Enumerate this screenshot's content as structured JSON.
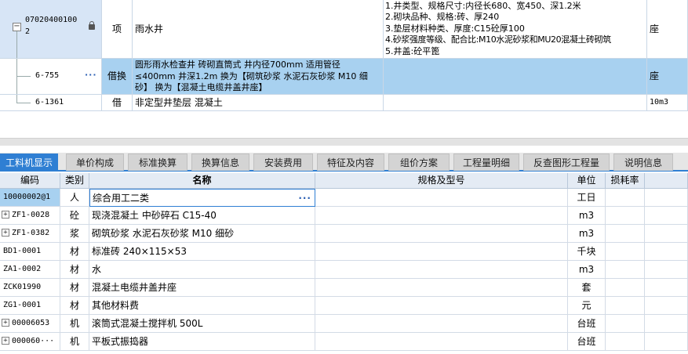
{
  "top_rows": [
    {
      "code": "070204001002",
      "code_line1": "07020400100",
      "code_line2": "2",
      "category": "项",
      "name": "雨水井",
      "features": [
        "1.井类型、规格尺寸:内径长680、宽450、深1.2米",
        "2.砌块品种、规格:砖、厚240",
        "3.垫层材料种类、厚度:C15砼厚100",
        "4.砂浆强度等级、配合比:M10水泥砂浆和MU20混凝土砖砌筑",
        "5.井盖:砼平篦"
      ],
      "unit": "座"
    },
    {
      "code": "6-755",
      "ellipsis": "···",
      "category": "借换",
      "name_lines": [
        "圆形雨水检查井 砖砌直筒式 井内径700mm 适用管径",
        "≤400mm 井深1.2m  换为【砌筑砂浆 水泥石灰砂浆 M10 细",
        "砂】  换为【混凝土电缆井盖井座】"
      ],
      "unit": "座"
    },
    {
      "code": "6-1361",
      "category": "借",
      "name": "非定型井垫层 混凝土",
      "unit": "10m3"
    }
  ],
  "tabs": [
    {
      "label": "工料机显示",
      "active": true
    },
    {
      "label": "单价构成",
      "active": false
    },
    {
      "label": "标准换算",
      "active": false
    },
    {
      "label": "换算信息",
      "active": false
    },
    {
      "label": "安装费用",
      "active": false
    },
    {
      "label": "特征及内容",
      "active": false
    },
    {
      "label": "组价方案",
      "active": false
    },
    {
      "label": "工程量明细",
      "active": false
    },
    {
      "label": "反查图形工程量",
      "active": false
    },
    {
      "label": "说明信息",
      "active": false
    }
  ],
  "bottom_headers": {
    "code": "编码",
    "type": "类别",
    "name": "名称",
    "spec": "规格及型号",
    "unit": "单位",
    "loss": "损耗率"
  },
  "bottom_rows": [
    {
      "code": "10000002@1",
      "type": "人",
      "name": "综合用工二类",
      "ellipsis": "···",
      "unit": "工日",
      "expandable": false
    },
    {
      "code": "ZF1-0028",
      "type": "砼",
      "name": "现浇混凝土 中砂碎石 C15-40",
      "unit": "m3",
      "expandable": true
    },
    {
      "code": "ZF1-0382",
      "type": "浆",
      "name": "砌筑砂浆 水泥石灰砂浆 M10 细砂",
      "unit": "m3",
      "expandable": true
    },
    {
      "code": "BD1-0001",
      "type": "材",
      "name": "标准砖 240×115×53",
      "unit": "千块",
      "expandable": false
    },
    {
      "code": "ZA1-0002",
      "type": "材",
      "name": "水",
      "unit": "m3",
      "expandable": false
    },
    {
      "code": "ZCK01990",
      "type": "材",
      "name": "混凝土电缆井盖井座",
      "unit": "套",
      "expandable": false
    },
    {
      "code": "ZG1-0001",
      "type": "材",
      "name": "其他材料费",
      "unit": "元",
      "expandable": false
    },
    {
      "code": "00006053",
      "type": "机",
      "name": "滚筒式混凝土搅拌机 500L",
      "unit": "台班",
      "expandable": true
    },
    {
      "code": "000060···",
      "type": "机",
      "name": "平板式振捣器",
      "unit": "台班",
      "expandable": true
    }
  ],
  "colors": {
    "selected_row": "#a8d1f0",
    "tab_active": "#2f7fd3",
    "header_bg": "#e4ebf4"
  },
  "icons": {
    "lock": "lock-icon",
    "expand": "plus-icon",
    "collapse": "minus-icon",
    "ellipsis": "ellipsis-icon"
  }
}
